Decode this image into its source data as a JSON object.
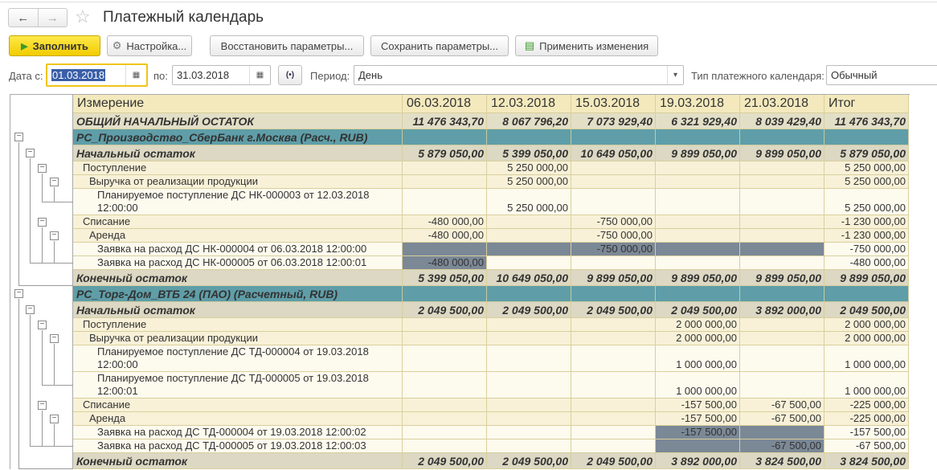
{
  "window": {
    "title": "Платежный календарь",
    "back_icon": "←",
    "forward_icon": "→",
    "favorite_icon": "☆"
  },
  "toolbar": {
    "fill": "Заполнить",
    "settings": "Настройка...",
    "restore": "Восстановить параметры...",
    "save": "Сохранить параметры...",
    "apply": "Применить изменения"
  },
  "filters": {
    "date_from_label": "Дата с:",
    "date_from": "01.03.2018",
    "date_to_label": "по:",
    "date_to": "31.03.2018",
    "period_label": "Период:",
    "period": "День",
    "type_label": "Тип платежного календаря:",
    "type": "Обычный"
  },
  "colors": {
    "group": "#5f9ea8",
    "section": "#dcd8c3",
    "highlight": "#7b8896",
    "header": "#f3e9bd",
    "primary": "#f1cc00"
  },
  "table": {
    "headers": [
      "Измерение",
      "06.03.2018",
      "12.03.2018",
      "15.03.2018",
      "19.03.2018",
      "21.03.2018",
      "Итог"
    ],
    "rows": [
      {
        "type": "total",
        "level": -1,
        "label": "ОБЩИЙ НАЧАЛЬНЫЙ ОСТАТОК",
        "values": [
          "11 476 343,70",
          "8 067 796,20",
          "7 073 929,40",
          "6 321 929,40",
          "8 039 429,40",
          "11 476 343,70"
        ]
      },
      {
        "type": "group",
        "level": 0,
        "label": "РС_Производство_СберБанк г.Москва (Расч., RUB)",
        "values": [
          "",
          "",
          "",
          "",
          "",
          ""
        ]
      },
      {
        "type": "section",
        "level": 1,
        "label": "Начальный остаток",
        "values": [
          "5 879 050,00",
          "5 399 050,00",
          "10 649 050,00",
          "9 899 050,00",
          "9 899 050,00",
          "5 879 050,00"
        ]
      },
      {
        "type": "norm",
        "level": 2,
        "indent": 1,
        "label": "Поступление",
        "values": [
          "",
          "5 250 000,00",
          "",
          "",
          "",
          "5 250 000,00"
        ]
      },
      {
        "type": "norm",
        "level": 3,
        "indent": 2,
        "label": "Выручка от реализации продукции",
        "values": [
          "",
          "5 250 000,00",
          "",
          "",
          "",
          "5 250 000,00"
        ]
      },
      {
        "type": "leaf",
        "level": 4,
        "indent": 3,
        "label": "Планируемое поступление ДС НК-000003 от 12.03.2018 12:00:00",
        "values": [
          "",
          "5 250 000,00",
          "",
          "",
          "",
          "5 250 000,00"
        ]
      },
      {
        "type": "norm",
        "level": 2,
        "indent": 1,
        "label": "Списание",
        "values": [
          "-480 000,00",
          "",
          "-750 000,00",
          "",
          "",
          "-1 230 000,00"
        ]
      },
      {
        "type": "norm",
        "level": 3,
        "indent": 2,
        "label": "Аренда",
        "values": [
          "-480 000,00",
          "",
          "-750 000,00",
          "",
          "",
          "-1 230 000,00"
        ]
      },
      {
        "type": "leaf",
        "level": 4,
        "indent": 3,
        "label": "Заявка на расход ДС НК-000004 от 06.03.2018 12:00:00",
        "values": [
          "",
          "",
          "-750 000,00",
          "",
          "",
          "-750 000,00"
        ],
        "hl": [
          0,
          1,
          2,
          3,
          4
        ]
      },
      {
        "type": "leaf",
        "level": 4,
        "indent": 3,
        "label": "Заявка на расход ДС НК-000005 от 06.03.2018 12:00:01",
        "values": [
          "-480 000,00",
          "",
          "",
          "",
          "",
          "-480 000,00"
        ],
        "hl": [
          0
        ]
      },
      {
        "type": "section",
        "level": 1,
        "label": "Конечный остаток",
        "values": [
          "5 399 050,00",
          "10 649 050,00",
          "9 899 050,00",
          "9 899 050,00",
          "9 899 050,00",
          "9 899 050,00"
        ]
      },
      {
        "type": "group",
        "level": 0,
        "label": "РС_Торг-Дом_ВТБ 24 (ПАО) (Расчетный, RUB)",
        "values": [
          "",
          "",
          "",
          "",
          "",
          ""
        ]
      },
      {
        "type": "section",
        "level": 1,
        "label": "Начальный остаток",
        "values": [
          "2 049 500,00",
          "2 049 500,00",
          "2 049 500,00",
          "2 049 500,00",
          "3 892 000,00",
          "2 049 500,00"
        ]
      },
      {
        "type": "norm",
        "level": 2,
        "indent": 1,
        "label": "Поступление",
        "values": [
          "",
          "",
          "",
          "2 000 000,00",
          "",
          "2 000 000,00"
        ]
      },
      {
        "type": "norm",
        "level": 3,
        "indent": 2,
        "label": "Выручка от реализации продукции",
        "values": [
          "",
          "",
          "",
          "2 000 000,00",
          "",
          "2 000 000,00"
        ]
      },
      {
        "type": "leaf",
        "level": 4,
        "indent": 3,
        "label": "Планируемое поступление ДС ТД-000004 от 19.03.2018 12:00:00",
        "values": [
          "",
          "",
          "",
          "1 000 000,00",
          "",
          "1 000 000,00"
        ]
      },
      {
        "type": "leaf",
        "level": 4,
        "indent": 3,
        "label": "Планируемое поступление ДС ТД-000005 от 19.03.2018 12:00:01",
        "values": [
          "",
          "",
          "",
          "1 000 000,00",
          "",
          "1 000 000,00"
        ]
      },
      {
        "type": "norm",
        "level": 2,
        "indent": 1,
        "label": "Списание",
        "values": [
          "",
          "",
          "",
          "-157 500,00",
          "-67 500,00",
          "-225 000,00"
        ]
      },
      {
        "type": "norm",
        "level": 3,
        "indent": 2,
        "label": "Аренда",
        "values": [
          "",
          "",
          "",
          "-157 500,00",
          "-67 500,00",
          "-225 000,00"
        ]
      },
      {
        "type": "leaf",
        "level": 4,
        "indent": 3,
        "label": "Заявка на расход ДС ТД-000004 от 19.03.2018 12:00:02",
        "values": [
          "",
          "",
          "",
          "-157 500,00",
          "",
          "-157 500,00"
        ],
        "hl": [
          3,
          4
        ]
      },
      {
        "type": "leaf",
        "level": 4,
        "indent": 3,
        "label": "Заявка на расход ДС ТД-000005 от 19.03.2018 12:00:03",
        "values": [
          "",
          "",
          "",
          "",
          "-67 500,00",
          "-67 500,00"
        ],
        "hl": [
          3,
          4
        ]
      },
      {
        "type": "section",
        "level": 1,
        "label": "Конечный остаток",
        "values": [
          "2 049 500,00",
          "2 049 500,00",
          "2 049 500,00",
          "3 892 000,00",
          "3 824 500,00",
          "3 824 500,00"
        ]
      }
    ]
  }
}
